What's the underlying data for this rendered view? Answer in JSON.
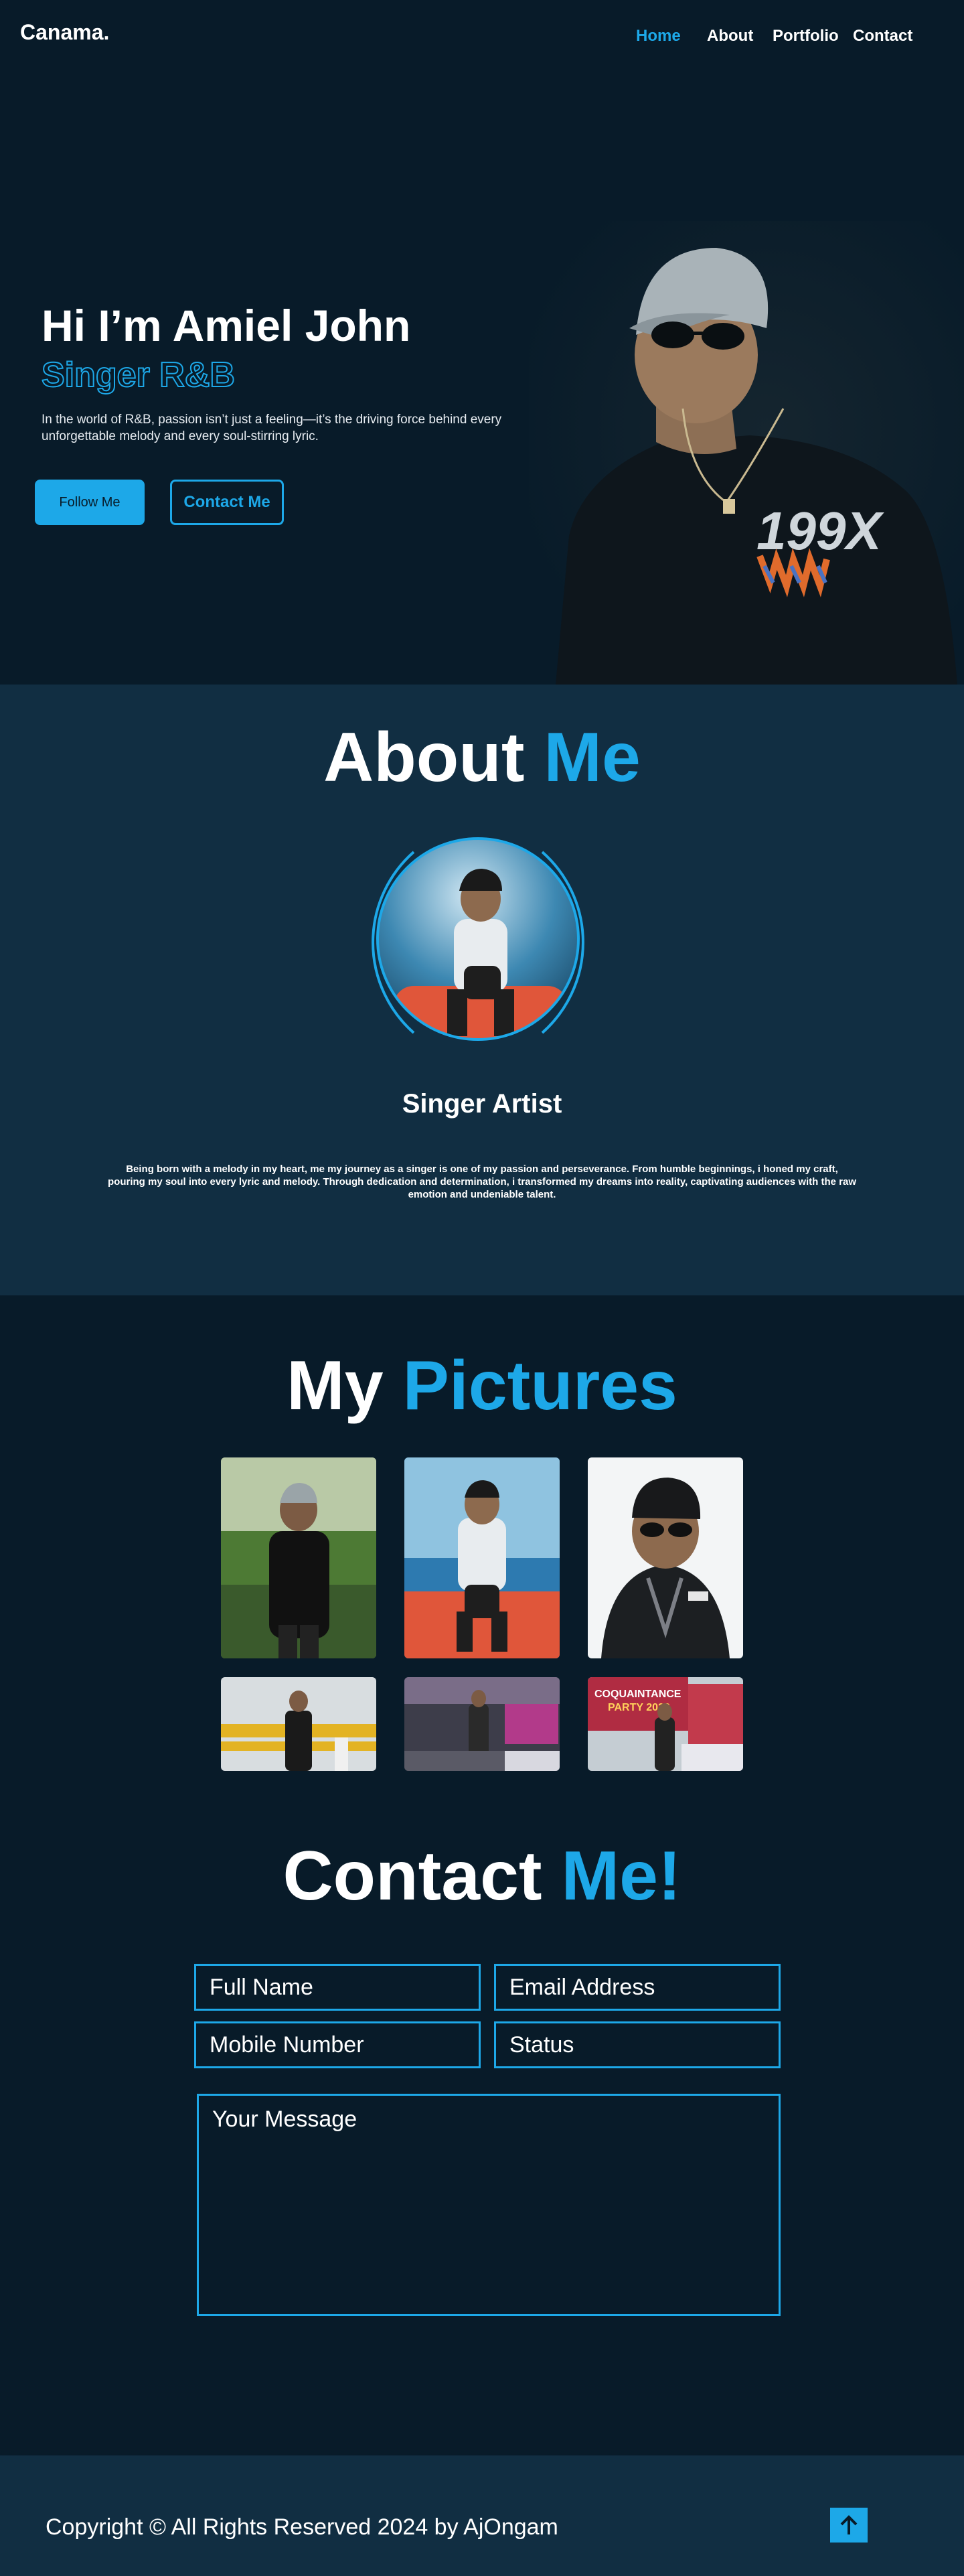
{
  "header": {
    "logo": "Canama.",
    "nav": [
      {
        "label": "Home",
        "active": true
      },
      {
        "label": "About",
        "active": false
      },
      {
        "label": "Portfolio",
        "active": false
      },
      {
        "label": "Contact",
        "active": false
      }
    ]
  },
  "hero": {
    "title": "Hi I’m Amiel John",
    "role": "Singer R&B",
    "text": "In the world of R&B, passion isn’t just a feeling—it’s the driving force behind every unforgettable melody and every soul-stirring lyric.",
    "follow_label": "Follow Me",
    "contact_label": "Contact Me",
    "shirt_print": "199X"
  },
  "about": {
    "title_main": "About",
    "title_accent": "Me",
    "subtitle": "Singer Artist",
    "text": "Being born with a melody in my heart, me my journey as a singer is one of my passion and perseverance. From humble beginnings, i honed my craft, pouring my soul into every lyric and melody. Through dedication and determination, i transformed my dreams into reality, captivating audiences with the raw emotion and undeniable talent."
  },
  "pictures": {
    "title_main": "My",
    "title_accent": "Pictures"
  },
  "contact": {
    "title_main": "Contact",
    "title_accent": "Me!",
    "full_name_placeholder": "Full Name",
    "email_placeholder": "Email Address",
    "mobile_placeholder": "Mobile Number",
    "status_placeholder": "Status",
    "message_placeholder": "Your Message"
  },
  "footer": {
    "copyright": "Copyright © All Rights Reserved 2024 by AjOngam"
  },
  "colors": {
    "background": "#081b29",
    "section_alt": "#112e42",
    "accent": "#1da8e8",
    "text": "#ffffff"
  },
  "icons": {
    "back_to_top": "arrow-up-icon"
  }
}
